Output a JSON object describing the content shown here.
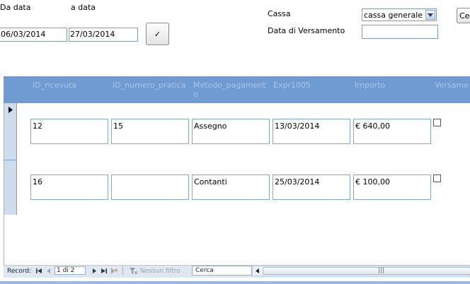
{
  "filter": {
    "from_label": "Da data",
    "to_label": "a data",
    "from_value": "06/03/2014",
    "to_value": "27/03/2014",
    "apply_button_glyph": "✓",
    "cassa_label": "Cassa",
    "cassa_value": "cassa generale",
    "data_versamento_label": "Data di Versamento",
    "data_versamento_value": "",
    "cut_button_label": "Ce"
  },
  "table": {
    "headers": [
      "ID_ricevuta",
      "ID_numero_pratica",
      "Metodo_pagament o",
      "Expr1005",
      "Importo",
      "Versame"
    ],
    "rows": [
      {
        "id_ricevuta": "12",
        "id_numero_pratica": "15",
        "metodo": "Assegno",
        "expr1005": "13/03/2014",
        "importo": "€ 640,00",
        "versamento": false
      },
      {
        "id_ricevuta": "16",
        "id_numero_pratica": "",
        "metodo": "Contanti",
        "expr1005": "25/03/2014",
        "importo": "€ 100,00",
        "versamento": false
      }
    ]
  },
  "navigation": {
    "record_label": "Record:",
    "position": "1 di 2",
    "filter_label": "Nessun filtro",
    "search_placeholder": "Cerca",
    "scroll_grip": "|||"
  },
  "icons": {
    "first": "first-record-icon",
    "prev": "previous-record-icon",
    "next": "next-record-icon",
    "last": "last-record-icon",
    "new": "new-record-icon",
    "filter": "filter-icon",
    "current_record": "current-record-arrow-icon",
    "dropdown": "chevron-down-icon",
    "check": "check-icon"
  },
  "colors": {
    "header_band": "#6f9bd2",
    "header_text": "#a9c6ea",
    "field_border": "#7f9db9",
    "record_selector": "#cfdcee"
  }
}
